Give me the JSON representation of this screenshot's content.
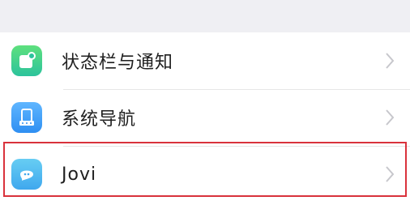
{
  "settings": {
    "items": [
      {
        "label": "状态栏与通知",
        "icon": "status-bar-notification-icon",
        "color": "#3ccf8e"
      },
      {
        "label": "系统导航",
        "icon": "system-navigation-icon",
        "color": "#3d9ff5"
      },
      {
        "label": "Jovi",
        "icon": "jovi-icon",
        "color": "#4cb4f0"
      }
    ]
  },
  "highlight": {
    "color": "#d9323c",
    "target": "Jovi"
  }
}
